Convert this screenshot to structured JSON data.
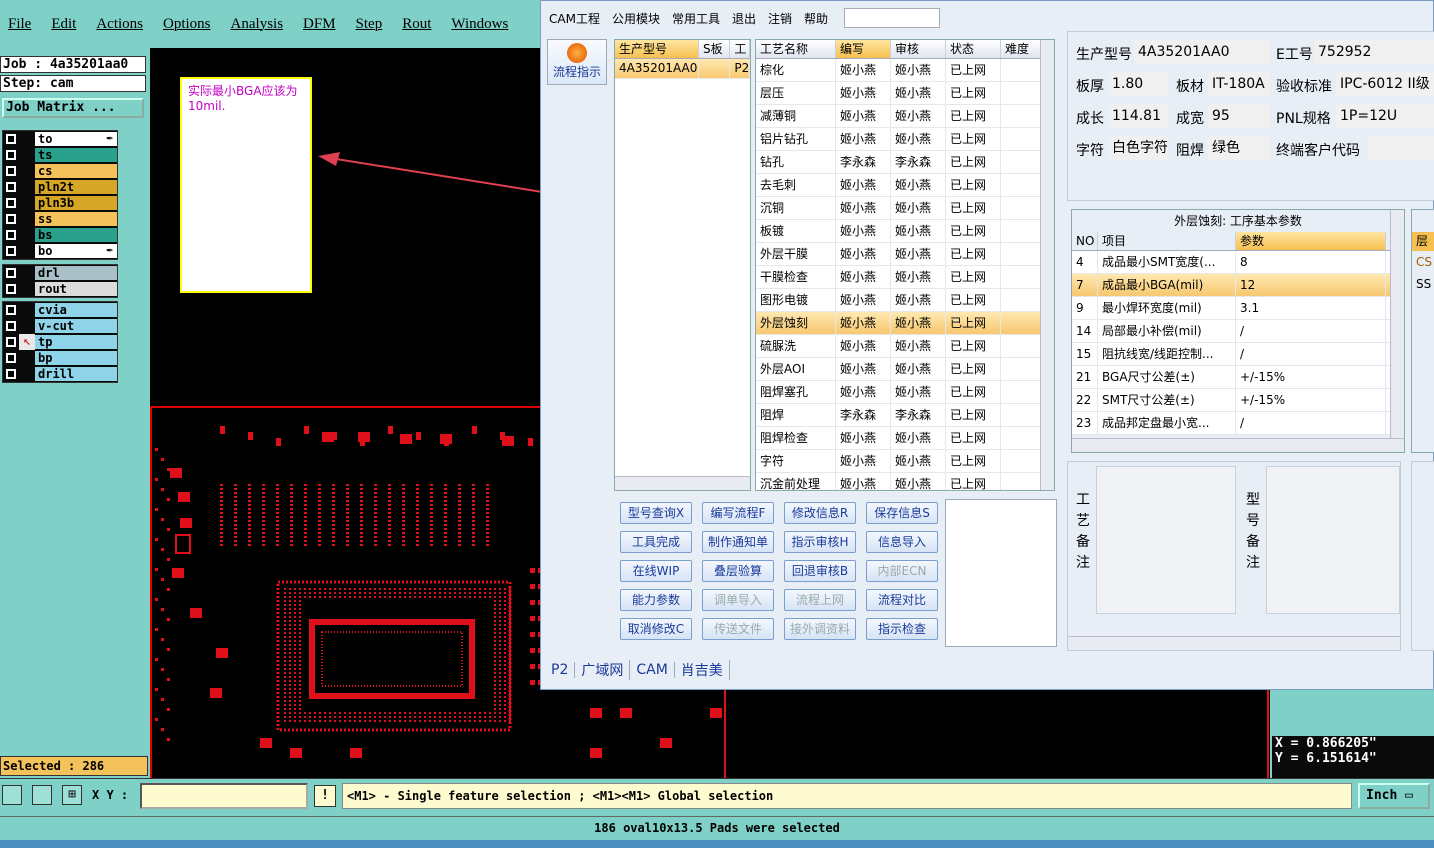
{
  "menubar": [
    "File",
    "Edit",
    "Actions",
    "Options",
    "Analysis",
    "DFM",
    "Step",
    "Rout",
    "Windows"
  ],
  "job": {
    "job_line": "Job : 4a35201aa0",
    "step_line": "Step: cam",
    "matrix_button": "Job Matrix ..."
  },
  "layers_group1": [
    {
      "name": "to",
      "color": "#ffffff",
      "lock": "✒"
    },
    {
      "name": "ts",
      "color": "#2aa18c",
      "lock": ""
    },
    {
      "name": "cs",
      "color": "#f3c25a",
      "lock": ""
    },
    {
      "name": "pln2t",
      "color": "#d6a626",
      "lock": ""
    },
    {
      "name": "pln3b",
      "color": "#d6a626",
      "lock": ""
    },
    {
      "name": "ss",
      "color": "#f3c25a",
      "lock": ""
    },
    {
      "name": "bs",
      "color": "#2aa18c",
      "lock": ""
    },
    {
      "name": "bo",
      "color": "#ffffff",
      "lock": "✒"
    }
  ],
  "layers_group2": [
    {
      "name": "drl",
      "color": "#a9c0c8"
    },
    {
      "name": "rout",
      "color": "#dcdcdc"
    }
  ],
  "layers_group3": [
    {
      "name": "cvia",
      "color": "#8fd3e8"
    },
    {
      "name": "v-cut",
      "color": "#8fd3e8"
    },
    {
      "name": "tp",
      "color": "#8fd3e8"
    },
    {
      "name": "bp",
      "color": "#8fd3e8"
    },
    {
      "name": "drill",
      "color": "#8fd3e8"
    }
  ],
  "selected": "Selected : 286",
  "note": "实际最小BGA应该为10mil.",
  "coords": {
    "x": "X = 0.866205\"",
    "y": "Y = 6.151614\""
  },
  "bottom": {
    "xy_label": "X Y :",
    "hint": "<M1> - Single feature selection ; <M1><M1> Global selection",
    "unit": "Inch"
  },
  "message": "186 oval10x13.5 Pads were selected",
  "win": {
    "menu": [
      "CAM工程",
      "公用模块",
      "常用工具",
      "退出",
      "注销",
      "帮助"
    ],
    "flow_button": "流程指示",
    "model_grid": {
      "headers": [
        "生产型号",
        "S板",
        "工"
      ],
      "rows": [
        [
          "4A35201AA0",
          "",
          "P2"
        ]
      ]
    },
    "process_grid": {
      "headers": [
        "工艺名称",
        "编写",
        "审核",
        "状态",
        "难度"
      ],
      "rows": [
        [
          "棕化",
          "姬小燕",
          "姬小燕",
          "已上网"
        ],
        [
          "层压",
          "姬小燕",
          "姬小燕",
          "已上网"
        ],
        [
          "减薄铜",
          "姬小燕",
          "姬小燕",
          "已上网"
        ],
        [
          "铝片钻孔",
          "姬小燕",
          "姬小燕",
          "已上网"
        ],
        [
          "钻孔",
          "李永森",
          "李永森",
          "已上网"
        ],
        [
          "去毛刺",
          "姬小燕",
          "姬小燕",
          "已上网"
        ],
        [
          "沉铜",
          "姬小燕",
          "姬小燕",
          "已上网"
        ],
        [
          "板镀",
          "姬小燕",
          "姬小燕",
          "已上网"
        ],
        [
          "外层干膜",
          "姬小燕",
          "姬小燕",
          "已上网"
        ],
        [
          "干膜检查",
          "姬小燕",
          "姬小燕",
          "已上网"
        ],
        [
          "图形电镀",
          "姬小燕",
          "姬小燕",
          "已上网"
        ],
        [
          "外层蚀刻",
          "姬小燕",
          "姬小燕",
          "已上网"
        ],
        [
          "硫脲洗",
          "姬小燕",
          "姬小燕",
          "已上网"
        ],
        [
          "外层AOI",
          "姬小燕",
          "姬小燕",
          "已上网"
        ],
        [
          "阻焊塞孔",
          "姬小燕",
          "姬小燕",
          "已上网"
        ],
        [
          "阻焊",
          "李永森",
          "李永森",
          "已上网"
        ],
        [
          "阻焊检查",
          "姬小燕",
          "姬小燕",
          "已上网"
        ],
        [
          "字符",
          "姬小燕",
          "姬小燕",
          "已上网"
        ],
        [
          "沉金前处理",
          "姬小燕",
          "姬小燕",
          "已上网"
        ]
      ],
      "selected_index": 11
    },
    "buttons": [
      [
        "型号查询X",
        "编写流程F",
        "修改信息R",
        "保存信息S"
      ],
      [
        "工具完成",
        "制作通知单",
        "指示审核H",
        "信息导入"
      ],
      [
        "在线WIP",
        "叠层验算",
        "回退审核B",
        "内部ECN"
      ],
      [
        "能力参数",
        "调单导入",
        "流程上网",
        "流程对比"
      ],
      [
        "取消修改C",
        "传送文件",
        "接外调资料",
        "指示检查"
      ]
    ],
    "disabled_buttons": [
      "内部ECN",
      "调单导入",
      "流程上网",
      "传送文件",
      "接外调资料"
    ],
    "info": {
      "labels": [
        "生产型号",
        "E工号",
        "板厚",
        "板材",
        "验收标准",
        "成长",
        "成宽",
        "PNL规格",
        "字符",
        "阻焊",
        "终端客户代码"
      ],
      "values": {
        "model": "4A35201AA0",
        "eno": "752952",
        "thickness": "1.80",
        "material": "IT-180A",
        "standard": "IPC-6012 II级",
        "length": "114.81",
        "width": "95",
        "pnl": "1P=12U",
        "char": "白色字符",
        "mask": "绿色",
        "customer": ""
      }
    },
    "params": {
      "title": "外层蚀刻: 工序基本参数",
      "headers": [
        "NO",
        "项目",
        "参数"
      ],
      "rows": [
        [
          "4",
          "成品最小SMT宽度(...",
          "8"
        ],
        [
          "7",
          "成品最小BGA(mil)",
          "12"
        ],
        [
          "9",
          "最小焊环宽度(mil)",
          "3.1"
        ],
        [
          "14",
          "局部最小补偿(mil)",
          "/"
        ],
        [
          "15",
          "阻抗线宽/线距控制...",
          "/"
        ],
        [
          "21",
          "BGA尺寸公差(±)",
          "+/-15%"
        ],
        [
          "22",
          "SMT尺寸公差(±)",
          "+/-15%"
        ],
        [
          "23",
          "成品邦定盘最小宽...",
          "/"
        ]
      ],
      "selected_index": 1
    },
    "right_mini": {
      "header": "层",
      "rows": [
        "CS",
        "SS"
      ]
    },
    "remarks": {
      "process": "工艺备注",
      "model": "型号备注"
    },
    "tabs": [
      "P2",
      "广域网",
      "CAM",
      "肖吉美"
    ]
  }
}
